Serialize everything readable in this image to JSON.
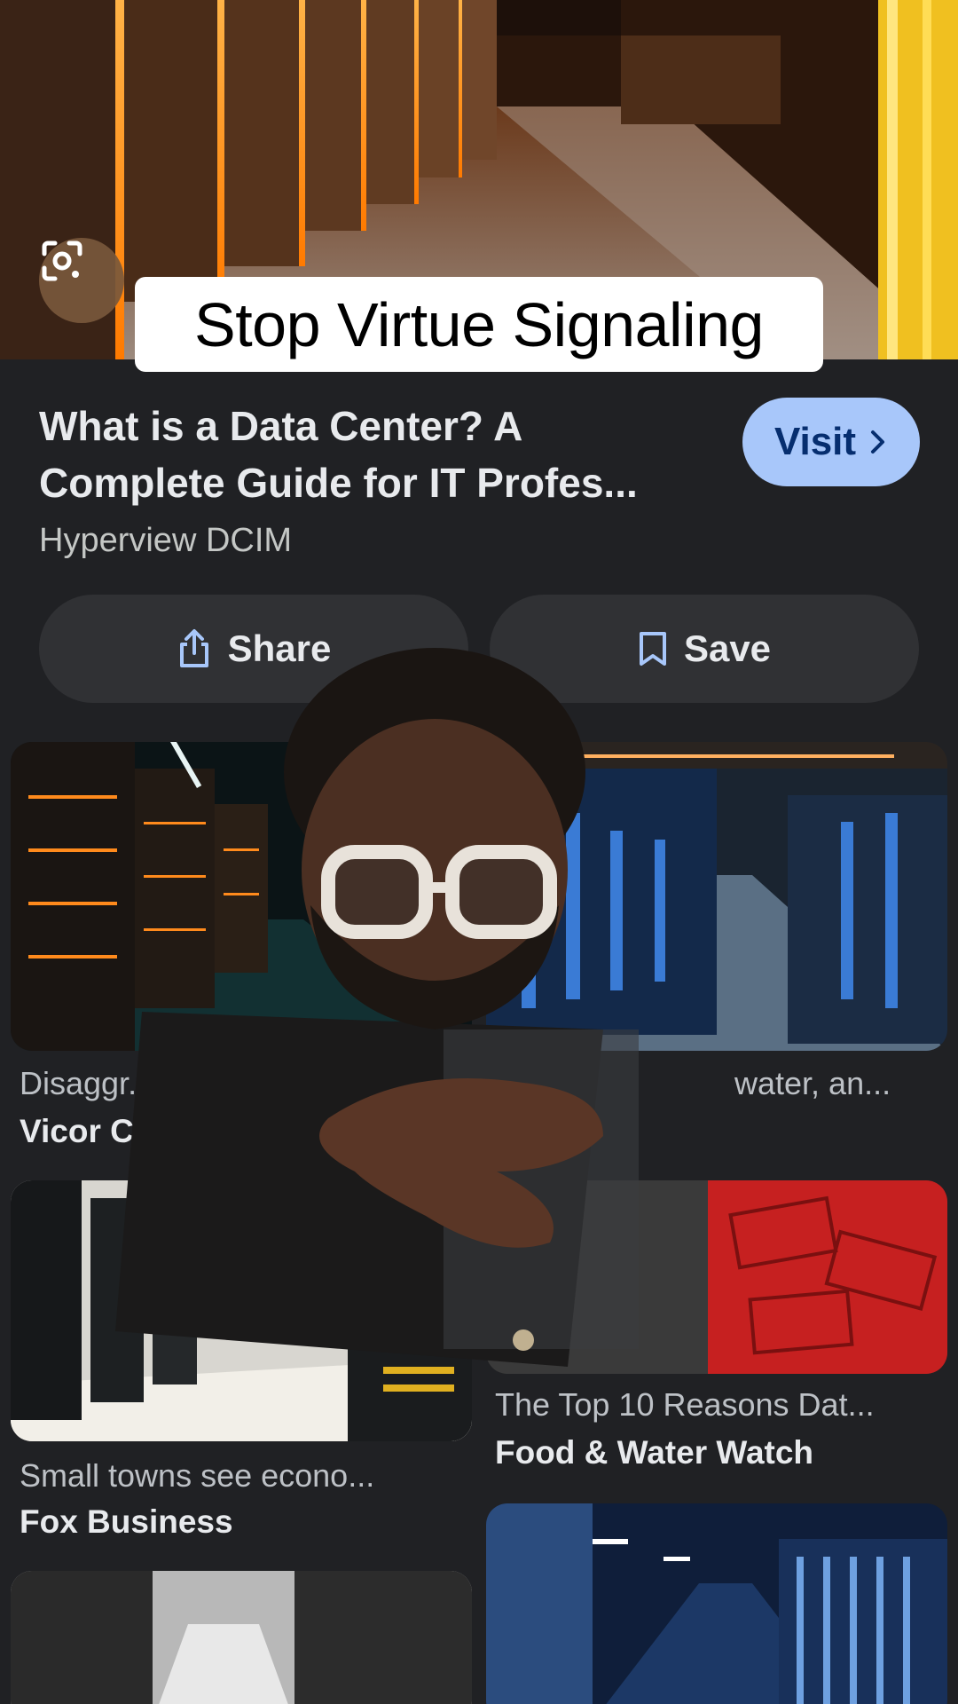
{
  "hero": {
    "caption": "Stop Virtue Signaling",
    "lens_icon": "google-lens-icon"
  },
  "result": {
    "title_line1": "What is a Data Center? A",
    "title_line2": "Complete Guide for IT Profes...",
    "source": "Hyperview DCIM",
    "visit_label": "Visit",
    "share_label": "Share",
    "save_label": "Save"
  },
  "related": [
    {
      "caption": "Disaggr...",
      "source": "Vicor C..."
    },
    {
      "caption": "water, an...",
      "source": ""
    },
    {
      "caption": "Small towns see econo...",
      "source": "Fox Business"
    },
    {
      "caption": "The Top 10 Reasons Dat...",
      "source": "Food & Water Watch"
    }
  ],
  "colors": {
    "background": "#202124",
    "visit_button": "#a8c7fa",
    "action_button": "#303134"
  }
}
